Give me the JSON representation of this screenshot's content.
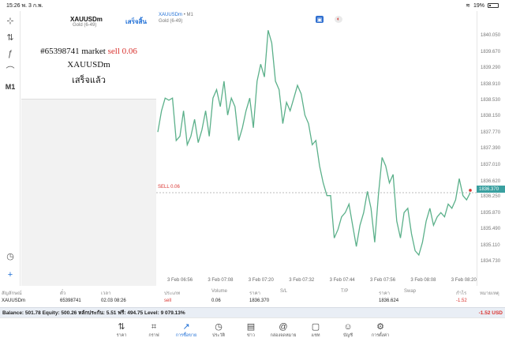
{
  "status": {
    "time": "15:26",
    "date": "พ. 3 ก.พ.",
    "battery": "19%"
  },
  "toolbar": {
    "crosshair": "⊹",
    "indicators": "⇅",
    "objects": "ƒ",
    "shapes": "⌒",
    "timeframe": "M1",
    "trade_history": "◷",
    "new_order": "+"
  },
  "order_panel": {
    "symbol": "XAUUSDm",
    "symbol_sub": "Gold (6-49)",
    "done_label": "เสร็จสิ้น",
    "message_line1_prefix": "#65398741 market ",
    "message_line1_action": "sell 0.06",
    "message_line2": "XAUUSDm",
    "message_line3": "เสร็จแล้ว"
  },
  "chart_header": {
    "symbol": "XAUUSDm",
    "sep": "•",
    "timeframe": "M1",
    "sub": "Gold (6-49)"
  },
  "chart_data": {
    "type": "line",
    "title": "",
    "price_ticks": [
      "1840.050",
      "1839.670",
      "1839.290",
      "1838.910",
      "1838.530",
      "1838.150",
      "1837.770",
      "1837.390",
      "1837.010",
      "1836.620",
      "1836.250",
      "1835.870",
      "1835.490",
      "1835.110",
      "1834.730"
    ],
    "time_ticks": [
      "3 Feb 06:56",
      "3 Feb 07:08",
      "3 Feb 07:20",
      "3 Feb 07:32",
      "3 Feb 07:44",
      "3 Feb 07:56",
      "3 Feb 08:08",
      "3 Feb 08:20"
    ],
    "ylim": [
      1834.73,
      1840.43
    ],
    "series": [
      {
        "values": [
          1837.8,
          1838.3,
          1838.6,
          1838.55,
          1838.6,
          1837.6,
          1837.7,
          1838.3,
          1837.5,
          1837.7,
          1838.1,
          1837.55,
          1837.85,
          1838.3,
          1837.7,
          1838.6,
          1838.8,
          1838.4,
          1839.0,
          1838.2,
          1838.6,
          1838.4,
          1837.6,
          1837.9,
          1838.3,
          1838.6,
          1837.9,
          1839.0,
          1839.4,
          1839.1,
          1840.2,
          1839.9,
          1839.0,
          1838.8,
          1838.0,
          1838.5,
          1838.3,
          1838.6,
          1838.9,
          1838.7,
          1838.2,
          1838.0,
          1837.5,
          1837.6,
          1837.0,
          1836.6,
          1836.3,
          1836.3,
          1835.3,
          1835.5,
          1835.8,
          1835.9,
          1836.1,
          1835.6,
          1835.1,
          1835.6,
          1835.9,
          1836.4,
          1836.0,
          1835.2,
          1836.3,
          1837.2,
          1837.0,
          1836.6,
          1836.8,
          1835.7,
          1835.3,
          1835.9,
          1836.0,
          1835.4,
          1835.0,
          1834.9,
          1835.2,
          1835.7,
          1836.0,
          1835.6,
          1835.8,
          1835.9,
          1835.8,
          1836.1,
          1836.0,
          1836.2,
          1836.7,
          1836.3,
          1836.2,
          1836.37
        ]
      }
    ],
    "sell_line": {
      "label": "SELL 0.06",
      "price": 1836.37
    },
    "current_price_label": "1836.370",
    "line_color": "#5bb08a",
    "sell_color": "#d9332f",
    "grid": false
  },
  "table": {
    "headers": [
      "สัญลักษณ์",
      "ตั๋ว",
      "เวลา",
      "ประเภท",
      "Volume",
      "ราคา",
      "S/L",
      "T/P",
      "ราคา",
      "Swap",
      "กำไร",
      "หมายเหตุ"
    ],
    "row": [
      "XAUUSDm",
      "65398741",
      "02.03 08:26",
      "sell",
      "0.06",
      "1836.370",
      "",
      "",
      "1836.624",
      "",
      "-1.52",
      ""
    ]
  },
  "balance": {
    "text": "Balance: 501.78 Equity: 500.26 หลักประกัน: 5.51 ฟรี: 494.75 Level: 9 079.13%",
    "profit": "-1.52",
    "currency": "USD"
  },
  "nav": [
    {
      "label": "ราคา",
      "icon": "⇅"
    },
    {
      "label": "กราฟ",
      "icon": "⌗"
    },
    {
      "label": "การซื้อขาย",
      "icon": "↗"
    },
    {
      "label": "ประวัติ",
      "icon": "◷"
    },
    {
      "label": "ข่าว",
      "icon": "▤"
    },
    {
      "label": "กล่องจดหมาย",
      "icon": "@"
    },
    {
      "label": "แชท",
      "icon": "▢"
    },
    {
      "label": "บัญชี",
      "icon": "☺"
    },
    {
      "label": "การตั้งค่า",
      "icon": "⚙"
    }
  ],
  "colors": {
    "accent": "#1f6fd6",
    "negative": "#d9332f",
    "chart_line": "#5bb08a"
  }
}
